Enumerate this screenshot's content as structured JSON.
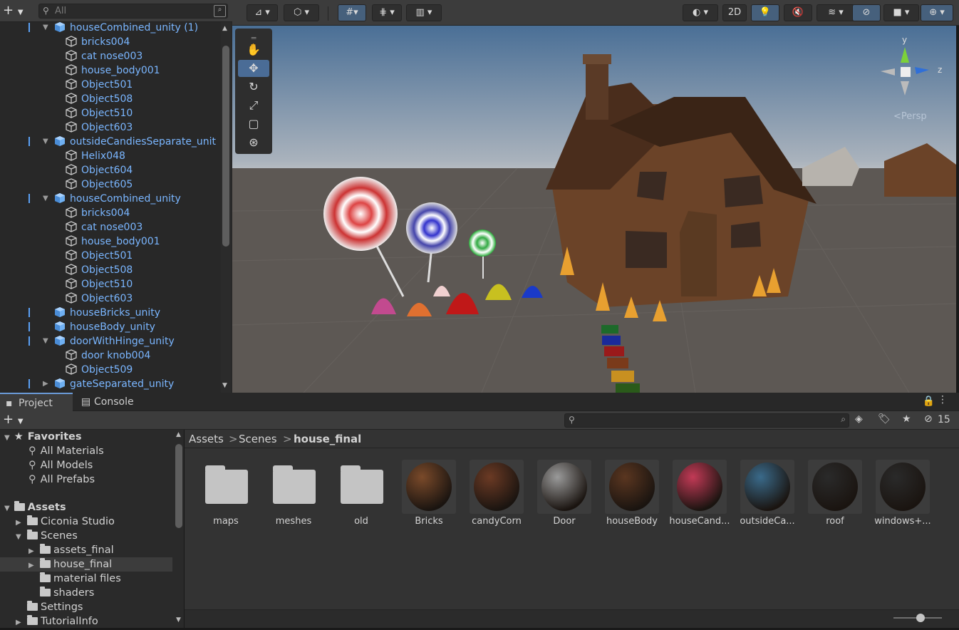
{
  "hierarchy": {
    "search_placeholder": "All",
    "rows": [
      {
        "label": "houseCombined_unity (1)",
        "indent": 1,
        "expanded": true,
        "kind": "prefab"
      },
      {
        "label": "bricks004",
        "indent": 2,
        "kind": "mesh"
      },
      {
        "label": "cat nose003",
        "indent": 2,
        "kind": "mesh"
      },
      {
        "label": "house_body001",
        "indent": 2,
        "kind": "mesh"
      },
      {
        "label": "Object501",
        "indent": 2,
        "kind": "mesh"
      },
      {
        "label": "Object508",
        "indent": 2,
        "kind": "mesh"
      },
      {
        "label": "Object510",
        "indent": 2,
        "kind": "mesh"
      },
      {
        "label": "Object603",
        "indent": 2,
        "kind": "mesh"
      },
      {
        "label": "outsideCandiesSeparate_unit",
        "indent": 1,
        "expanded": true,
        "kind": "prefab"
      },
      {
        "label": "Helix048",
        "indent": 2,
        "kind": "mesh"
      },
      {
        "label": "Object604",
        "indent": 2,
        "kind": "mesh"
      },
      {
        "label": "Object605",
        "indent": 2,
        "kind": "mesh"
      },
      {
        "label": "houseCombined_unity",
        "indent": 1,
        "expanded": true,
        "kind": "prefab"
      },
      {
        "label": "bricks004",
        "indent": 2,
        "kind": "mesh"
      },
      {
        "label": "cat nose003",
        "indent": 2,
        "kind": "mesh"
      },
      {
        "label": "house_body001",
        "indent": 2,
        "kind": "mesh"
      },
      {
        "label": "Object501",
        "indent": 2,
        "kind": "mesh"
      },
      {
        "label": "Object508",
        "indent": 2,
        "kind": "mesh"
      },
      {
        "label": "Object510",
        "indent": 2,
        "kind": "mesh"
      },
      {
        "label": "Object603",
        "indent": 2,
        "kind": "mesh"
      },
      {
        "label": "houseBricks_unity",
        "indent": 1,
        "kind": "prefab"
      },
      {
        "label": "houseBody_unity",
        "indent": 1,
        "kind": "prefab"
      },
      {
        "label": "doorWithHinge_unity",
        "indent": 1,
        "expanded": true,
        "kind": "prefab"
      },
      {
        "label": "door knob004",
        "indent": 2,
        "kind": "mesh"
      },
      {
        "label": "Object509",
        "indent": 2,
        "kind": "mesh"
      },
      {
        "label": "gateSeparated_unity",
        "indent": 1,
        "expanded": false,
        "kind": "prefab"
      }
    ]
  },
  "scene_toolbar": {
    "btn_2d": "2D",
    "persp_label": "<Persp",
    "gizmo_y": "y",
    "gizmo_z": "z"
  },
  "tabs": {
    "project": "Project",
    "console": "Console"
  },
  "project_toolbar": {
    "hidden_count": "15"
  },
  "tree": {
    "favorites_label": "Favorites",
    "favorites": [
      "All Materials",
      "All Models",
      "All Prefabs"
    ],
    "assets_label": "Assets",
    "folders": [
      {
        "label": "Ciconia Studio",
        "indent": 1,
        "arrow": "right"
      },
      {
        "label": "Scenes",
        "indent": 1,
        "arrow": "down"
      },
      {
        "label": "assets_final",
        "indent": 2,
        "arrow": "right"
      },
      {
        "label": "house_final",
        "indent": 2,
        "arrow": "right",
        "selected": true
      },
      {
        "label": "material files",
        "indent": 2,
        "arrow": "none"
      },
      {
        "label": "shaders",
        "indent": 2,
        "arrow": "none"
      },
      {
        "label": "Settings",
        "indent": 1,
        "arrow": "none"
      },
      {
        "label": "TutorialInfo",
        "indent": 1,
        "arrow": "right"
      }
    ]
  },
  "breadcrumb": [
    "Assets",
    "Scenes",
    "house_final"
  ],
  "assets": [
    {
      "label": "maps",
      "type": "folder"
    },
    {
      "label": "meshes",
      "type": "folder"
    },
    {
      "label": "old",
      "type": "folder"
    },
    {
      "label": "Bricks",
      "type": "material",
      "color": "#7a4a2a"
    },
    {
      "label": "candyCorn",
      "type": "material",
      "color": "#6b3a24"
    },
    {
      "label": "Door",
      "type": "material",
      "color": "#9a9a9a"
    },
    {
      "label": "houseBody",
      "type": "material",
      "color": "#5a3620"
    },
    {
      "label": "houseCand...",
      "type": "material",
      "color": "#c23a56"
    },
    {
      "label": "outsideCa...",
      "type": "material",
      "color": "#3a6a8a"
    },
    {
      "label": "roof",
      "type": "material",
      "color": "#2a2a2a"
    },
    {
      "label": "windows+...",
      "type": "material",
      "color": "#2a2a2a"
    }
  ],
  "colors": {
    "accent": "#4a6c96",
    "hierarchy_prefab_text": "#7ab6ff",
    "panel": "#282828",
    "toolbar": "#3c3c3c"
  }
}
